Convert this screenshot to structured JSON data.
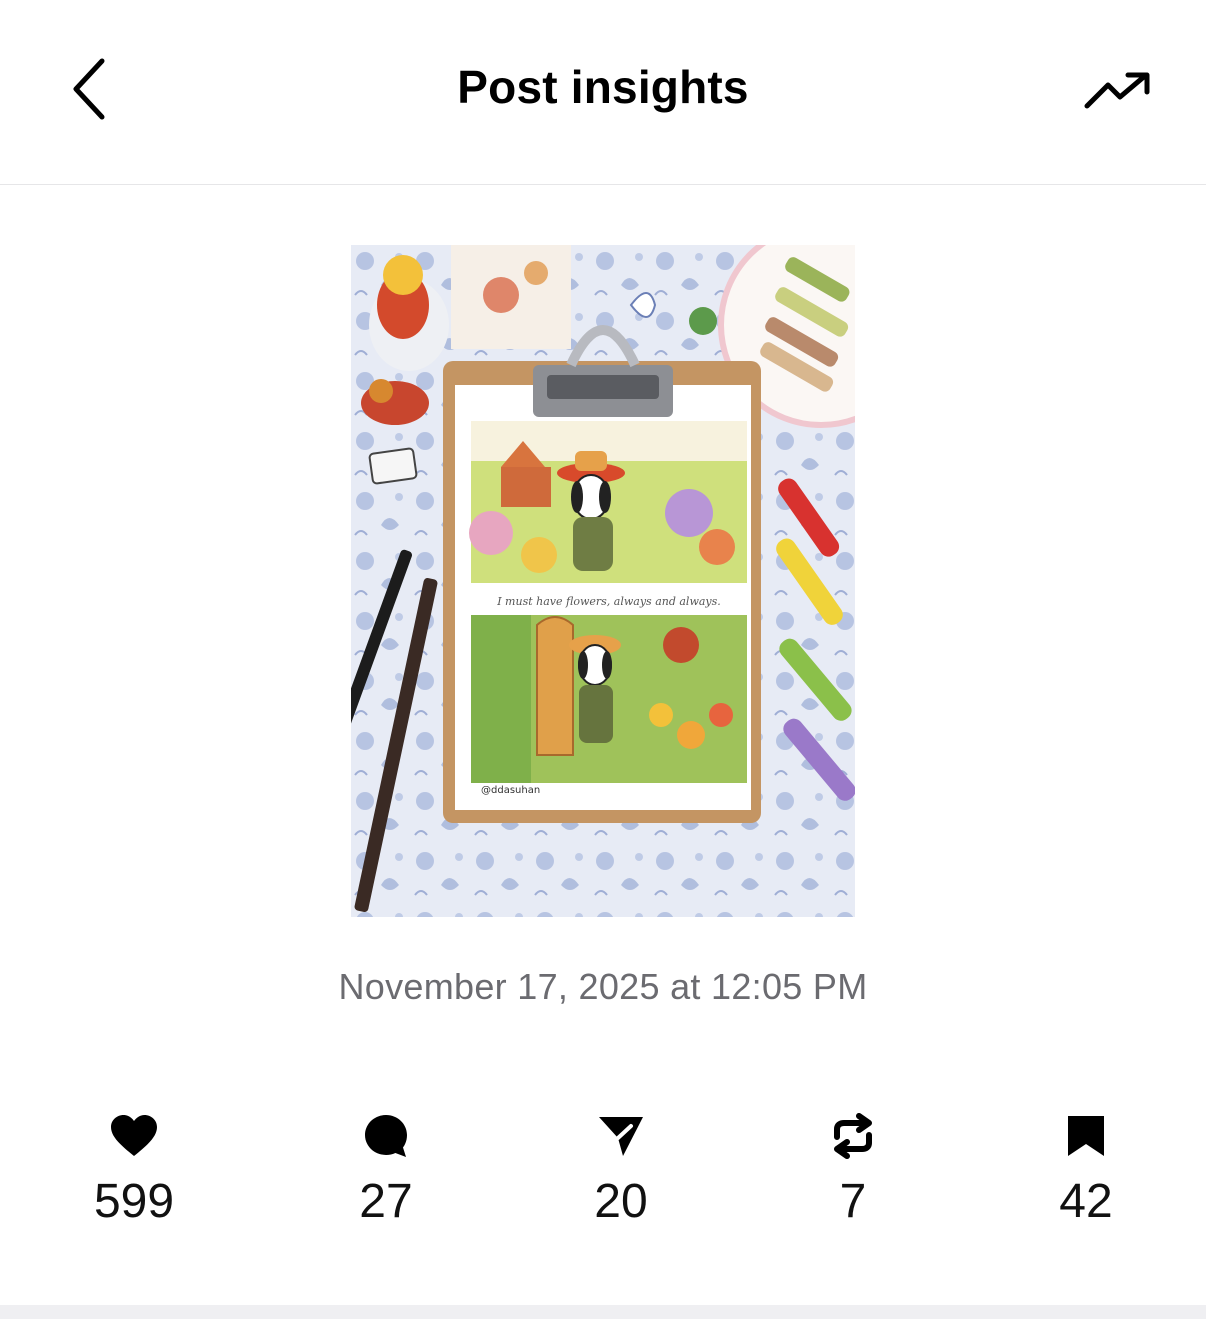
{
  "header": {
    "title": "Post insights",
    "back_icon": "chevron-left-icon",
    "trend_icon": "trending-up-icon"
  },
  "post": {
    "image_icon": "post-thumbnail",
    "handwriting": "I must have flowers, always and always.",
    "signature": "@ddasuhan",
    "date": "November 17, 2025 at 12:05 PM"
  },
  "metrics": [
    {
      "icon": "heart-icon",
      "value": "599"
    },
    {
      "icon": "comment-icon",
      "value": "27"
    },
    {
      "icon": "share-icon",
      "value": "20"
    },
    {
      "icon": "repost-icon",
      "value": "7"
    },
    {
      "icon": "bookmark-icon",
      "value": "42"
    }
  ],
  "colors": {
    "text": "#000000",
    "muted": "#6b6b70",
    "divider": "#e6e6e8"
  }
}
